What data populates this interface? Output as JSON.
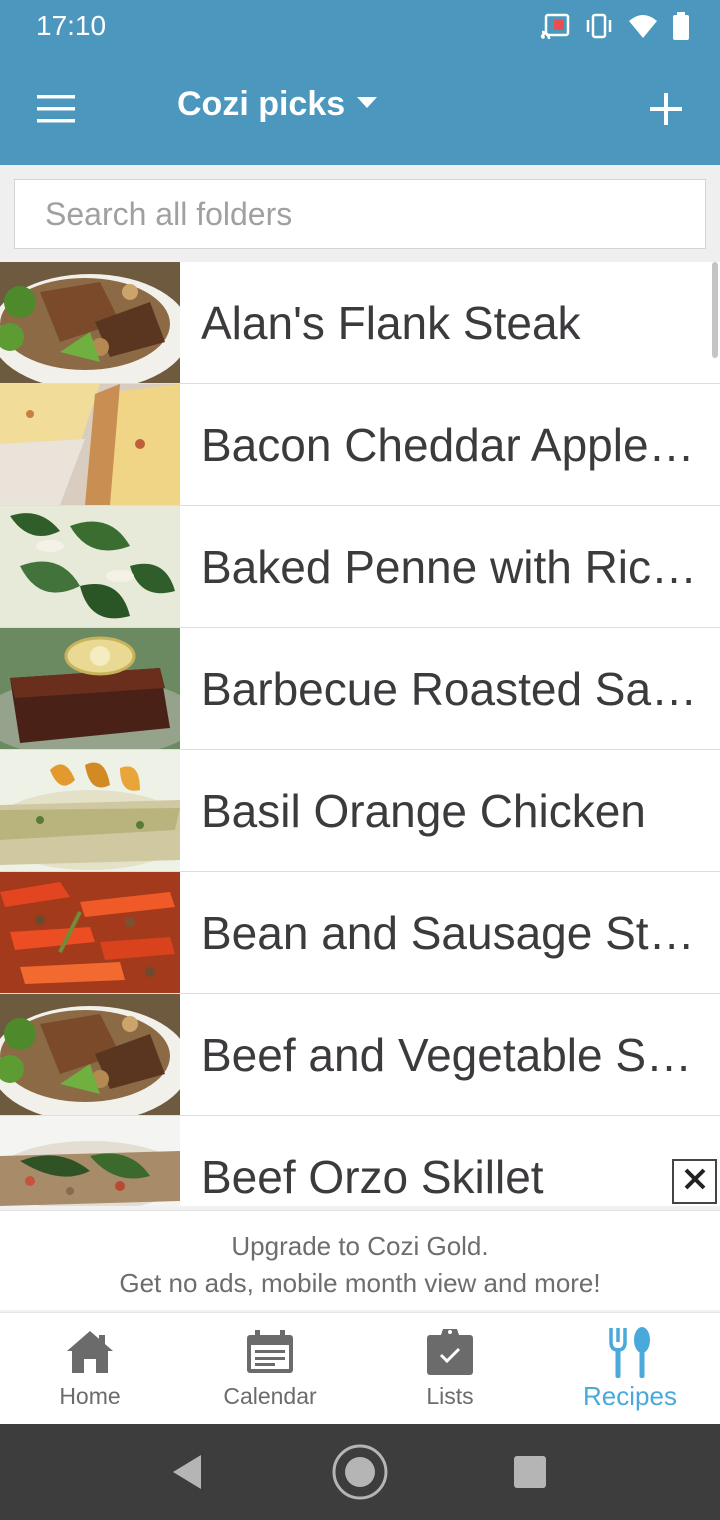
{
  "status_bar": {
    "time": "17:10",
    "icons": [
      "cast-icon",
      "vibrate-icon",
      "wifi-icon",
      "battery-icon"
    ]
  },
  "app_bar": {
    "title": "Cozi picks",
    "menu_icon": "hamburger-menu-icon",
    "dropdown_icon": "caret-down-icon",
    "add_icon": "plus-icon"
  },
  "search": {
    "placeholder": "Search all folders",
    "value": ""
  },
  "recipes": [
    {
      "name": "Alan's Flank Steak",
      "thumb": "steak"
    },
    {
      "name": "Bacon Cheddar Apple…",
      "thumb": "quiche"
    },
    {
      "name": "Baked Penne with Ric…",
      "thumb": "spinach"
    },
    {
      "name": "Barbecue Roasted Sal…",
      "thumb": "salmon"
    },
    {
      "name": "Basil Orange Chicken",
      "thumb": "chicken"
    },
    {
      "name": "Bean and Sausage St…",
      "thumb": "stew"
    },
    {
      "name": "Beef and Vegetable S…",
      "thumb": "steak"
    },
    {
      "name": "Beef Orzo Skillet",
      "thumb": "orzo"
    }
  ],
  "ad": {
    "close_icon": "close-icon",
    "line1": "Upgrade to Cozi Gold.",
    "line2": "Get no ads, mobile month view and more!"
  },
  "bottom_nav": {
    "items": [
      {
        "label": "Home",
        "icon": "home-icon",
        "active": false
      },
      {
        "label": "Calendar",
        "icon": "calendar-icon",
        "active": false
      },
      {
        "label": "Lists",
        "icon": "clipboard-check-icon",
        "active": false
      },
      {
        "label": "Recipes",
        "icon": "fork-spoon-icon",
        "active": true
      }
    ]
  },
  "system_nav": {
    "back_icon": "back-triangle-icon",
    "home_icon": "home-circle-icon",
    "recents_icon": "recents-square-icon"
  },
  "colors": {
    "header_blue": "#4b97be",
    "active_nav": "#4aa9db",
    "inactive_nav": "#6b6b6b",
    "recipe_text": "#3d3a3e"
  }
}
